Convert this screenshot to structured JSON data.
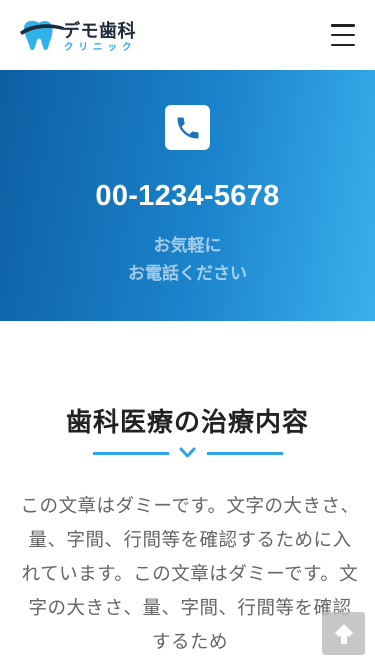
{
  "header": {
    "logo_title": "デモ歯科",
    "logo_subtitle": "クリニック",
    "menu_icon": "hamburger-icon"
  },
  "hero": {
    "phone_icon": "phone-icon",
    "phone_number": "00-1234-5678",
    "cta_line1": "お気軽に",
    "cta_line2": "お電話ください"
  },
  "section": {
    "title": "歯科医療の治療内容",
    "divider_icon": "chevron-down-icon",
    "body": "この文章はダミーです。文字の大きさ、量、字間、行間等を確認するために入れています。この文章はダミーです。文字の大きさ、量、字間、行間等を確認するため"
  },
  "back_to_top_icon": "arrow-up-icon",
  "colors": {
    "accent": "#2aa6e8",
    "hero_start": "#0e5fa3",
    "hero_end": "#3ab0ec"
  }
}
